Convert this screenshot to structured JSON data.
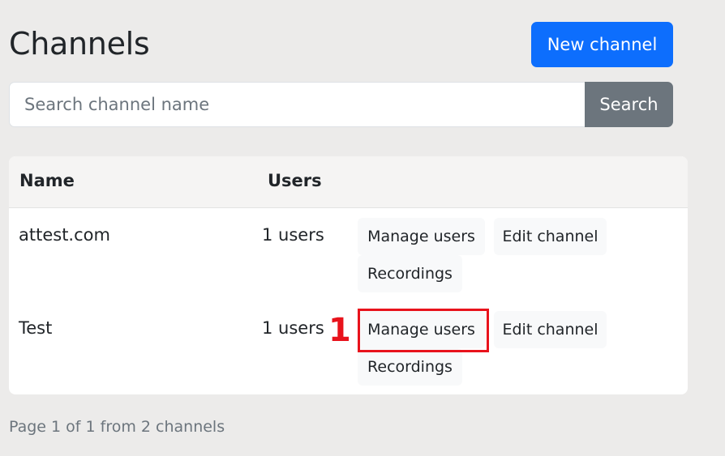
{
  "page": {
    "title": "Channels",
    "new_channel_label": "New channel"
  },
  "search": {
    "placeholder": "Search channel name",
    "value": "",
    "button_label": "Search"
  },
  "table": {
    "headers": [
      "Name",
      "Users"
    ],
    "rows": [
      {
        "name": "attest.com",
        "users": "1 users",
        "actions": [
          "Manage users",
          "Edit channel",
          "Recordings"
        ]
      },
      {
        "name": "Test",
        "users": "1 users",
        "actions": [
          "Manage users",
          "Edit channel",
          "Recordings"
        ]
      }
    ]
  },
  "annotation": {
    "label": "1",
    "color": "#e8131c"
  },
  "footer": {
    "pagination": "Page 1 of 1 from 2 channels"
  },
  "colors": {
    "primary": "#0d6efd",
    "secondary": "#6c757d",
    "background": "#ecebea"
  }
}
